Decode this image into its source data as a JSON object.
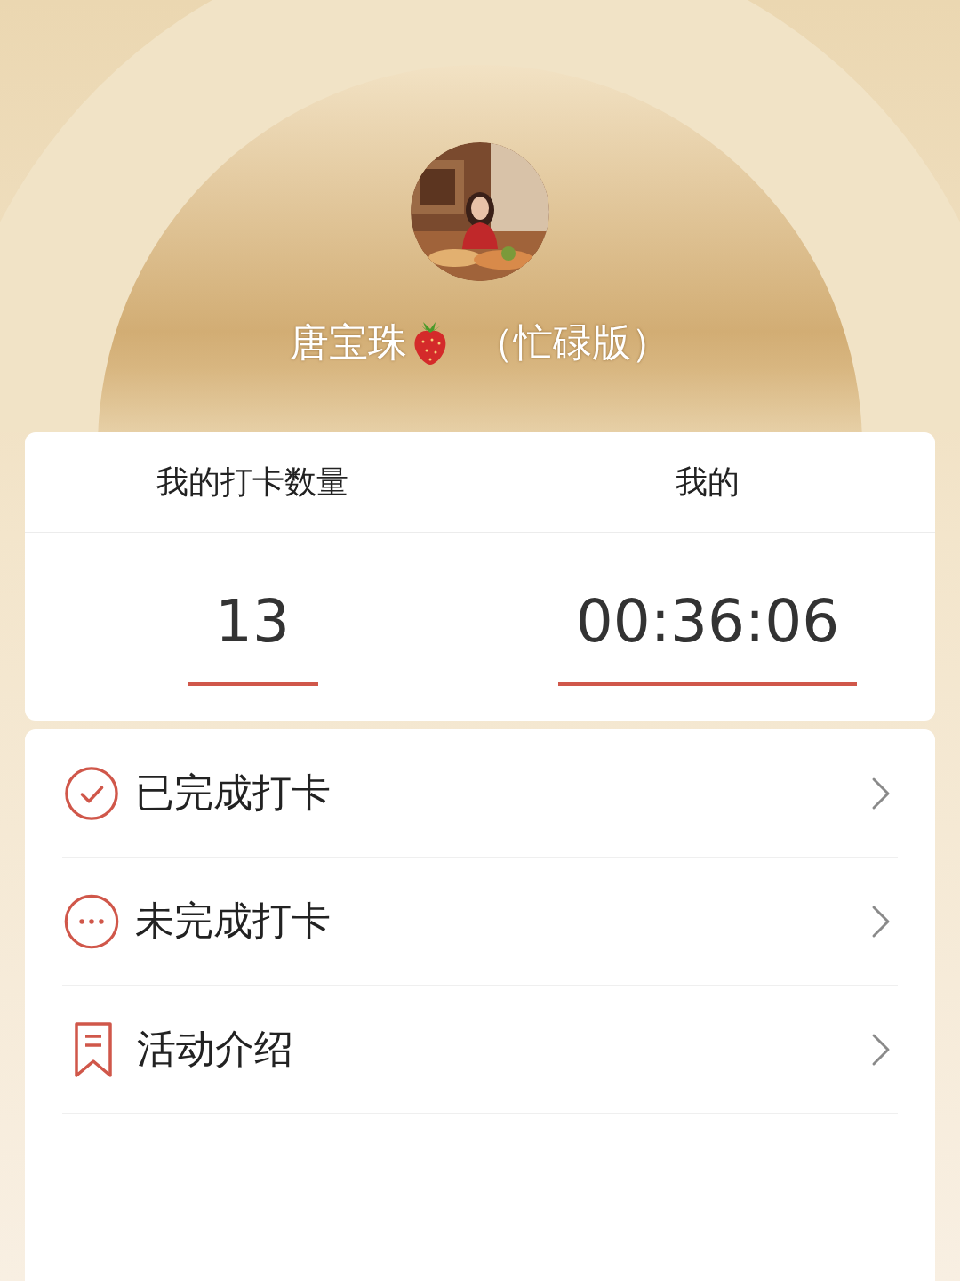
{
  "profile": {
    "name": "唐宝珠",
    "suffix": "（忙碌版）"
  },
  "stats": [
    {
      "label": "我的打卡数量",
      "value": "13"
    },
    {
      "label": "我的",
      "value": "00:36:06"
    }
  ],
  "menu": [
    {
      "kind": "done",
      "label": "已完成打卡"
    },
    {
      "kind": "pending",
      "label": "未完成打卡"
    },
    {
      "kind": "info",
      "label": "活动介绍"
    }
  ]
}
